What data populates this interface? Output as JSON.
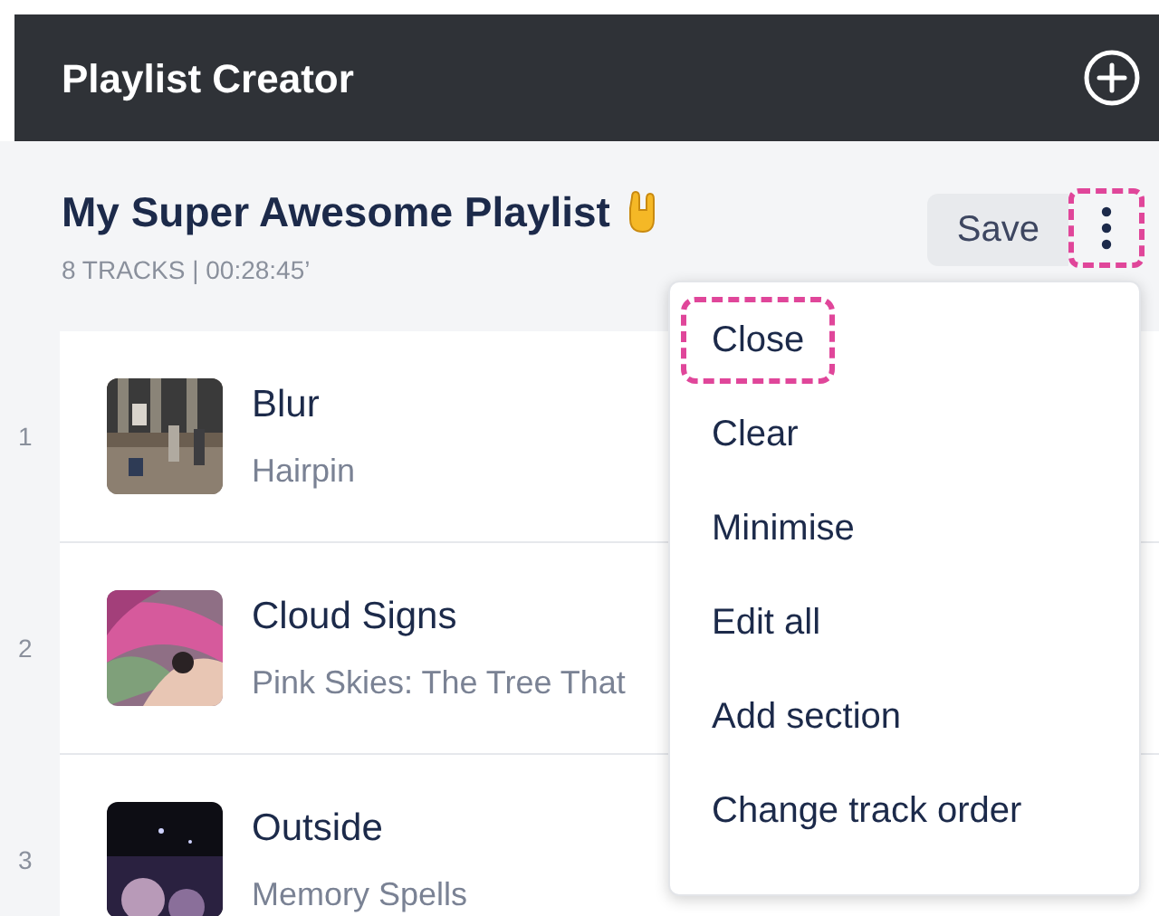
{
  "header": {
    "title": "Playlist Creator"
  },
  "playlist": {
    "title": "My Super Awesome Playlist",
    "meta": "8 TRACKS | 00:28:45’"
  },
  "save_button": {
    "label": "Save"
  },
  "more_button": {
    "highlighted": true
  },
  "tracks": [
    {
      "number": "1",
      "title": "Blur",
      "subtitle": "Hairpin"
    },
    {
      "number": "2",
      "title": "Cloud Signs",
      "subtitle": "Pink Skies: The Tree That"
    },
    {
      "number": "3",
      "title": "Outside",
      "subtitle": "Memory Spells"
    }
  ],
  "menu": {
    "items": [
      {
        "label": "Close",
        "highlighted": true
      },
      {
        "label": "Clear",
        "highlighted": false
      },
      {
        "label": "Minimise",
        "highlighted": false
      },
      {
        "label": "Edit all",
        "highlighted": false
      },
      {
        "label": "Add section",
        "highlighted": false
      },
      {
        "label": "Change track order",
        "highlighted": false
      }
    ]
  }
}
